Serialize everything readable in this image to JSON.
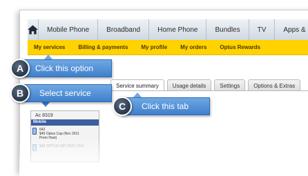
{
  "top_nav": {
    "items": [
      "Mobile Phone",
      "Broadband",
      "Home Phone",
      "Bundles",
      "TV",
      "Apps &"
    ]
  },
  "sub_nav": {
    "items": [
      "My services",
      "Billing & payments",
      "My profile",
      "My orders",
      "Optus Rewards"
    ]
  },
  "account_panel": {
    "account_label": "Ac          8319",
    "section_label": "Mobile",
    "rows": [
      {
        "line1": "642",
        "line2": "$49 Optus Cap (Nov 2011",
        "line3": "Prem Hset)"
      },
      {
        "line1": "",
        "line2": "$49 OPTUS CAP (NOV 2011",
        "line3": ""
      }
    ]
  },
  "tabs": [
    "Service summary",
    "Usage details",
    "Settings",
    "Options & Extras"
  ],
  "callouts": {
    "a": {
      "letter": "A",
      "text": "Click this option"
    },
    "b": {
      "letter": "B",
      "text": "Select service"
    },
    "c": {
      "letter": "C",
      "text": "Click this tab"
    }
  },
  "colors": {
    "subnav": "#ffd200",
    "callout": "#4f8fd8",
    "badge": "#28374a"
  }
}
